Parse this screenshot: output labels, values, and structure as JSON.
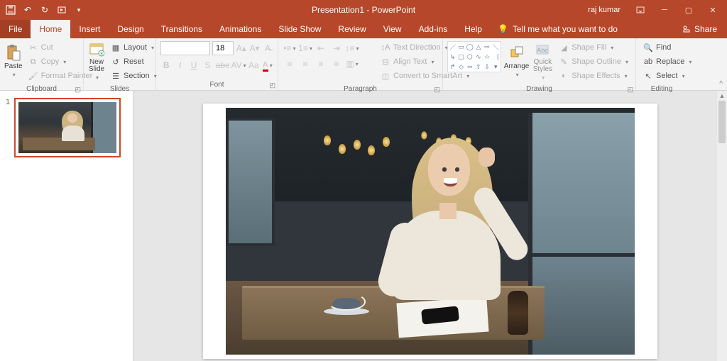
{
  "title": "Presentation1 - PowerPoint",
  "user": "raj kumar",
  "share": "Share",
  "tabs": {
    "file": "File",
    "home": "Home",
    "insert": "Insert",
    "design": "Design",
    "transitions": "Transitions",
    "animations": "Animations",
    "slideshow": "Slide Show",
    "review": "Review",
    "view": "View",
    "addins": "Add-ins",
    "help": "Help"
  },
  "tellme": "Tell me what you want to do",
  "clipboard": {
    "paste": "Paste",
    "cut": "Cut",
    "copy": "Copy",
    "format_painter": "Format Painter",
    "group": "Clipboard"
  },
  "slides": {
    "new_slide": "New\nSlide",
    "layout": "Layout",
    "reset": "Reset",
    "section": "Section",
    "group": "Slides"
  },
  "font": {
    "name": "",
    "size": "18",
    "group": "Font"
  },
  "paragraph": {
    "text_direction": "Text Direction",
    "align_text": "Align Text",
    "convert_smartart": "Convert to SmartArt",
    "group": "Paragraph"
  },
  "drawing": {
    "arrange": "Arrange",
    "quick_styles": "Quick\nStyles",
    "shape_fill": "Shape Fill",
    "shape_outline": "Shape Outline",
    "shape_effects": "Shape Effects",
    "group": "Drawing"
  },
  "editing": {
    "find": "Find",
    "replace": "Replace",
    "select": "Select",
    "group": "Editing"
  },
  "slide_numbers": [
    "1"
  ]
}
